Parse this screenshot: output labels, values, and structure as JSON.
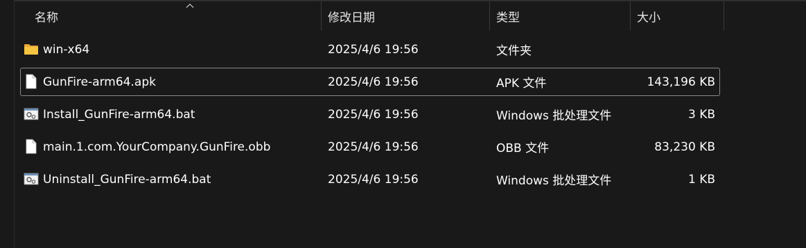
{
  "columns": {
    "name": "名称",
    "date": "修改日期",
    "type": "类型",
    "size": "大小"
  },
  "files": [
    {
      "name": "win-x64",
      "date": "2025/4/6 19:56",
      "type": "文件夹",
      "size": "",
      "icon": "folder-icon"
    },
    {
      "name": "GunFire-arm64.apk",
      "date": "2025/4/6 19:56",
      "type": "APK 文件",
      "size": "143,196 KB",
      "icon": "file-icon"
    },
    {
      "name": "Install_GunFire-arm64.bat",
      "date": "2025/4/6 19:56",
      "type": "Windows 批处理文件",
      "size": "3 KB",
      "icon": "batch-file-icon"
    },
    {
      "name": "main.1.com.YourCompany.GunFire.obb",
      "date": "2025/4/6 19:56",
      "type": "OBB 文件",
      "size": "83,230 KB",
      "icon": "file-icon"
    },
    {
      "name": "Uninstall_GunFire-arm64.bat",
      "date": "2025/4/6 19:56",
      "type": "Windows 批处理文件",
      "size": "1 KB",
      "icon": "batch-file-icon"
    }
  ],
  "selected_index": 1,
  "colors": {
    "background": "#191919",
    "folder": "#f5c542",
    "selection_border": "#8a8a8a"
  }
}
